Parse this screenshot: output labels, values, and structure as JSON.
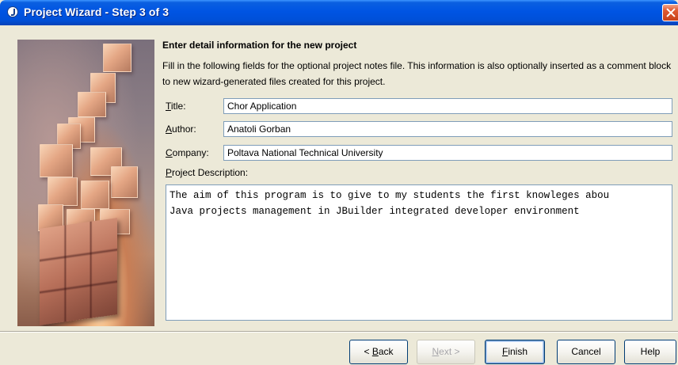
{
  "window": {
    "title": "Project Wizard - Step 3 of 3",
    "icon": "jbuilder-app-icon",
    "title_bar_color": "#0054e3"
  },
  "main": {
    "heading": "Enter detail information for the new project",
    "intro": "Fill in the following fields for the optional project notes file. This information is also optionally inserted as a comment block to new wizard-generated files created for this project."
  },
  "fields": {
    "title": {
      "label_mnemonic": "T",
      "label_rest": "itle:",
      "value": "Chor Application"
    },
    "author": {
      "label_mnemonic": "A",
      "label_rest": "uthor:",
      "value": "Anatoli Gorban"
    },
    "company": {
      "label_mnemonic": "C",
      "label_rest": "ompany:",
      "value": "Poltava National Technical University"
    }
  },
  "description": {
    "label_mnemonic": "P",
    "label_rest": "roject Description:",
    "lines": [
      "The aim of this program is to give to my students the first knowleges abou",
      "Java projects management in JBuilder integrated developer environment"
    ]
  },
  "buttons": {
    "back": {
      "prefix": "< ",
      "mnemonic": "B",
      "rest": "ack",
      "enabled": true
    },
    "next": {
      "mnemonic": "N",
      "rest": "ext >",
      "enabled": false
    },
    "finish": {
      "mnemonic": "F",
      "rest": "inish",
      "enabled": true
    },
    "cancel": {
      "label": "Cancel",
      "enabled": true
    },
    "help": {
      "label": "Help",
      "enabled": true
    }
  }
}
